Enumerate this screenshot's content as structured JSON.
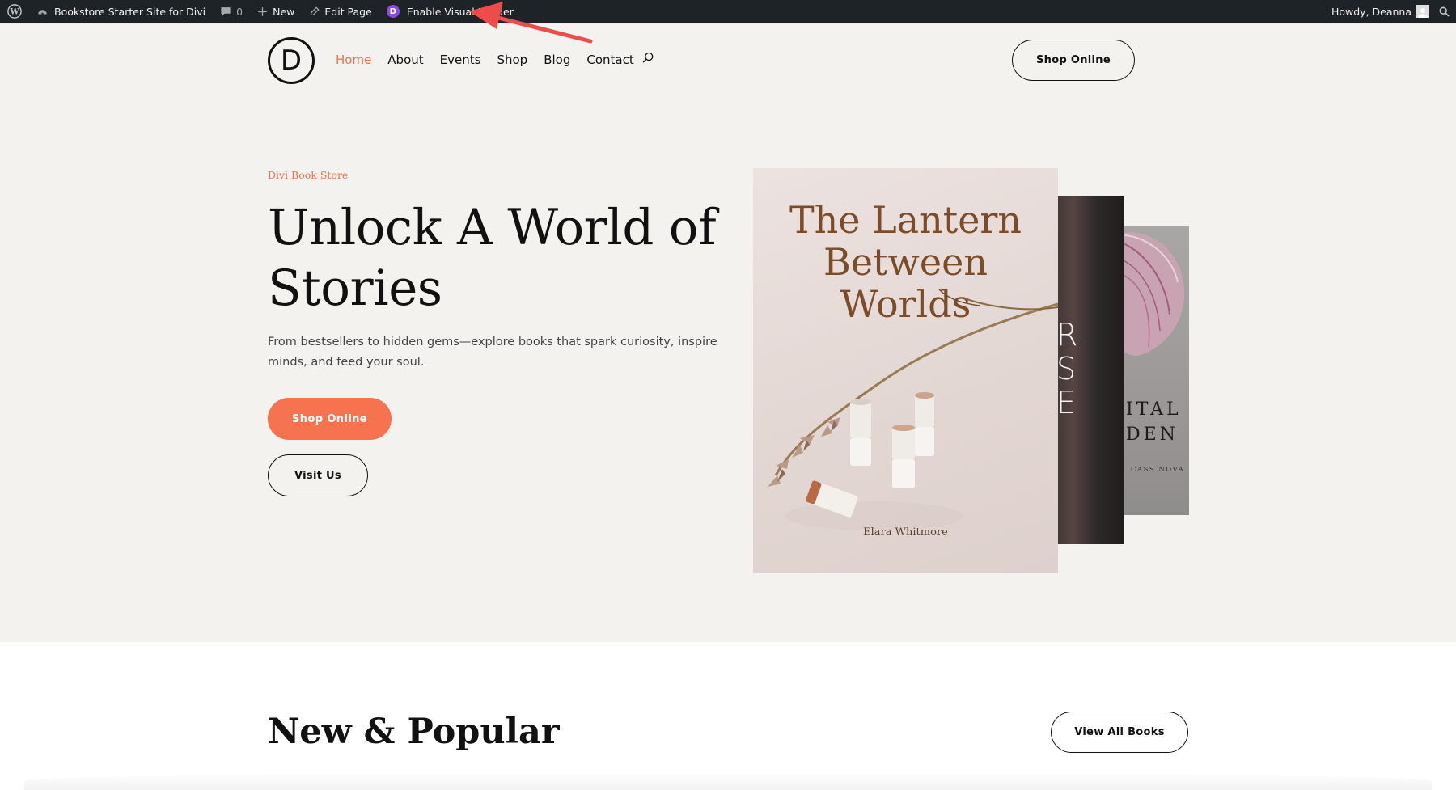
{
  "admin_bar": {
    "site_name": "Bookstore Starter Site for Divi",
    "comments_count": "0",
    "new_label": "New",
    "edit_label": "Edit Page",
    "visual_builder_label": "Enable Visual Builder",
    "divi_letter": "D",
    "howdy": "Howdy, Deanna"
  },
  "header": {
    "logo_letter": "D",
    "nav": [
      "Home",
      "About",
      "Events",
      "Shop",
      "Blog",
      "Contact"
    ],
    "active_nav": "Home",
    "shop_button": "Shop Online"
  },
  "hero": {
    "eyebrow": "Divi Book Store",
    "headline_line1": "Unlock A World of",
    "headline_line2": "Stories",
    "description": "From bestsellers to hidden gems—explore books that spark curiosity, inspire minds, and feed your soul.",
    "primary_button": "Shop Online",
    "secondary_button": "Visit Us"
  },
  "books": {
    "front_title_line1": "The Lantern",
    "front_title_line2": "Between",
    "front_title_line3": "Worlds",
    "front_author": "Elara Whitmore",
    "middle_letters": [
      "R",
      "S",
      "E"
    ],
    "back_title_line1": "ITAL",
    "back_title_line2": "DEN",
    "back_author": "CASS NOVA"
  },
  "section": {
    "title": "New & Popular",
    "view_all_button": "View All Books"
  },
  "colors": {
    "accent": "#f7734f",
    "admin_bar": "#1d2327",
    "page_bg": "#f4f2ee",
    "annotation_arrow": "#ee4b4b"
  }
}
